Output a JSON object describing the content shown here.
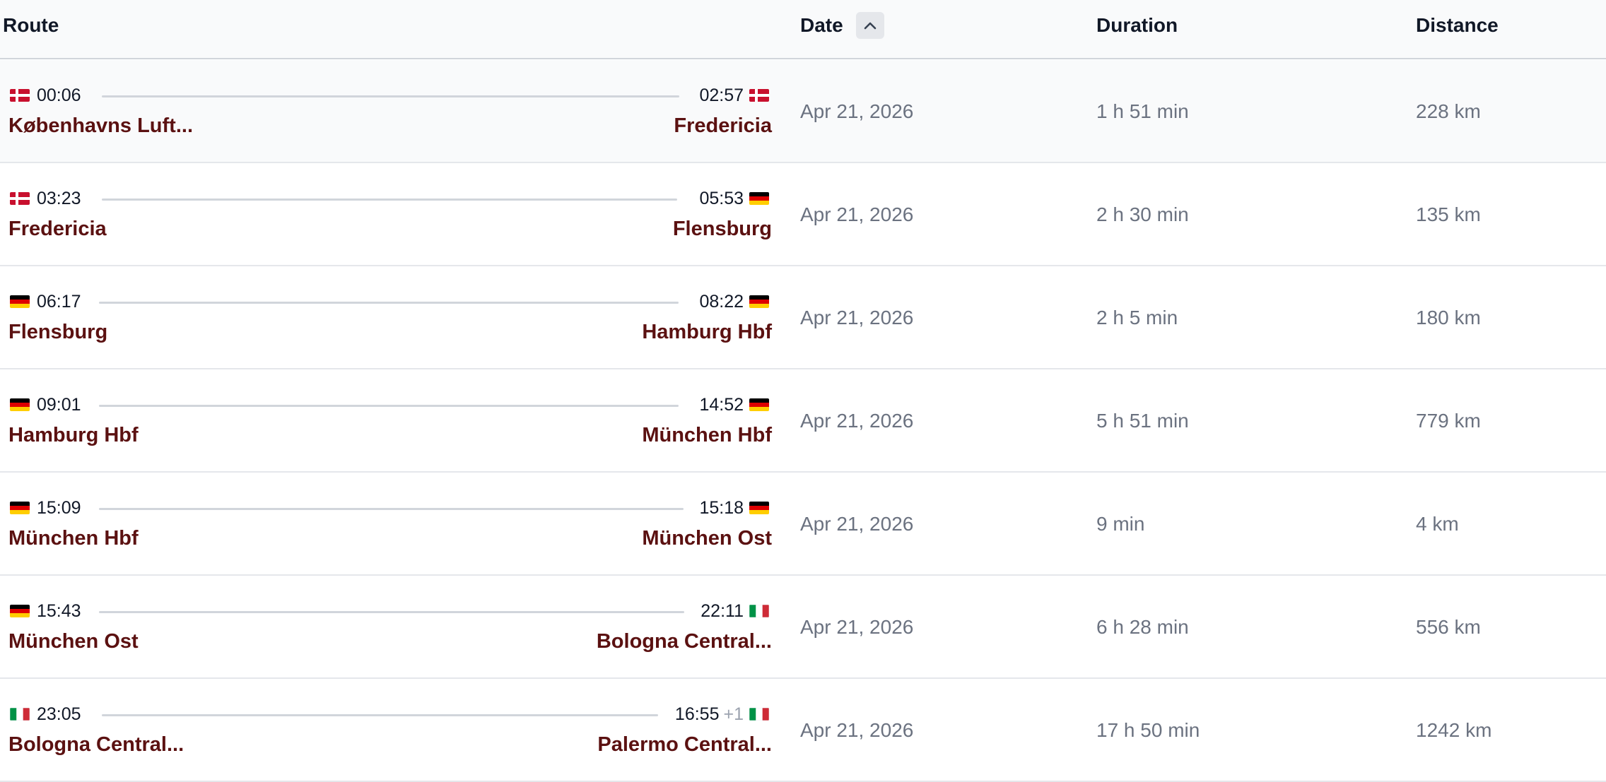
{
  "columns": {
    "route": "Route",
    "date": "Date",
    "duration": "Duration",
    "distance": "Distance"
  },
  "sort": {
    "column": "date",
    "direction": "ascending",
    "icon": "chevron-up-icon"
  },
  "rows": [
    {
      "dep_time": "00:06",
      "dep_flag": "dk",
      "dep_station": "Københavns Luft...",
      "arr_time": "02:57",
      "arr_day_offset": "",
      "arr_flag": "dk",
      "arr_station": "Fredericia",
      "date": "Apr 21, 2026",
      "duration": "1 h 51 min",
      "distance": "228 km"
    },
    {
      "dep_time": "03:23",
      "dep_flag": "dk",
      "dep_station": "Fredericia",
      "arr_time": "05:53",
      "arr_day_offset": "",
      "arr_flag": "de",
      "arr_station": "Flensburg",
      "date": "Apr 21, 2026",
      "duration": "2 h 30 min",
      "distance": "135 km"
    },
    {
      "dep_time": "06:17",
      "dep_flag": "de",
      "dep_station": "Flensburg",
      "arr_time": "08:22",
      "arr_day_offset": "",
      "arr_flag": "de",
      "arr_station": "Hamburg Hbf",
      "date": "Apr 21, 2026",
      "duration": "2 h 5 min",
      "distance": "180 km"
    },
    {
      "dep_time": "09:01",
      "dep_flag": "de",
      "dep_station": "Hamburg Hbf",
      "arr_time": "14:52",
      "arr_day_offset": "",
      "arr_flag": "de",
      "arr_station": "München Hbf",
      "date": "Apr 21, 2026",
      "duration": "5 h 51 min",
      "distance": "779 km"
    },
    {
      "dep_time": "15:09",
      "dep_flag": "de",
      "dep_station": "München Hbf",
      "arr_time": "15:18",
      "arr_day_offset": "",
      "arr_flag": "de",
      "arr_station": "München Ost",
      "date": "Apr 21, 2026",
      "duration": "9 min",
      "distance": "4 km"
    },
    {
      "dep_time": "15:43",
      "dep_flag": "de",
      "dep_station": "München Ost",
      "arr_time": "22:11",
      "arr_day_offset": "",
      "arr_flag": "it",
      "arr_station": "Bologna Central...",
      "date": "Apr 21, 2026",
      "duration": "6 h 28 min",
      "distance": "556 km"
    },
    {
      "dep_time": "23:05",
      "dep_flag": "it",
      "dep_station": "Bologna Central...",
      "arr_time": "16:55",
      "arr_day_offset": "+1",
      "arr_flag": "it",
      "arr_station": "Palermo Central...",
      "date": "Apr 21, 2026",
      "duration": "17 h 50 min",
      "distance": "1242 km"
    }
  ]
}
